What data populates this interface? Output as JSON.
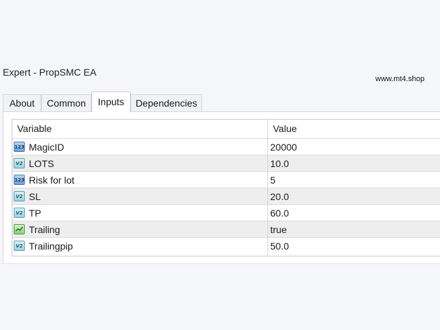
{
  "window": {
    "title": "Expert - PropSMC EA",
    "watermark": "www.mt4.shop"
  },
  "tabs": [
    {
      "label": "About",
      "active": false
    },
    {
      "label": "Common",
      "active": false
    },
    {
      "label": "Inputs",
      "active": true
    },
    {
      "label": "Dependencies",
      "active": false
    }
  ],
  "table": {
    "columns": [
      "Variable",
      "Value"
    ],
    "rows": [
      {
        "icon": "int-icon",
        "name": "MagicID",
        "value": "20000"
      },
      {
        "icon": "double-icon",
        "name": "LOTS",
        "value": "10.0"
      },
      {
        "icon": "int-icon",
        "name": "Risk for lot",
        "value": "5"
      },
      {
        "icon": "double-icon",
        "name": "SL",
        "value": "20.0"
      },
      {
        "icon": "double-icon",
        "name": "TP",
        "value": "60.0"
      },
      {
        "icon": "bool-icon",
        "name": "Trailing",
        "value": "true"
      },
      {
        "icon": "double-icon",
        "name": "Trailingpip",
        "value": "50.0"
      }
    ]
  }
}
